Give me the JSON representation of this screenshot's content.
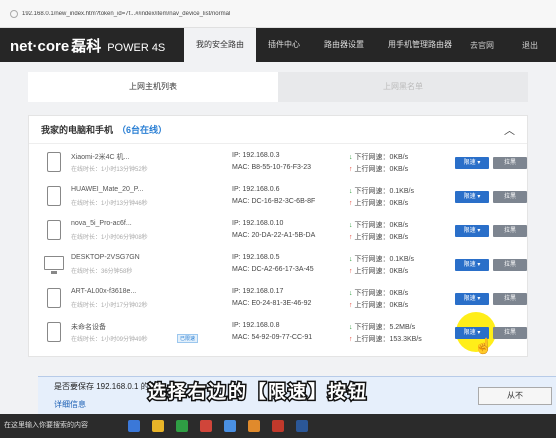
{
  "browser": {
    "url": "192.168.0.1/new_index.htm?token_id=7f...#/index/item/nav_device_list/normal"
  },
  "router": {
    "logo_brand": "net·core",
    "logo_cn": "磊科",
    "logo_model": "POWER 4S",
    "nav": [
      "我的安全路由",
      "插件中心",
      "路由器设置",
      "用手机管理路由器"
    ],
    "official_site": "去官网",
    "exit": "退出"
  },
  "subtabs": [
    "上网主机列表",
    "上网黑名单"
  ],
  "panel": {
    "title": "我家的电脑和手机",
    "online": "（6台在线）"
  },
  "devices": [
    {
      "name": "Xiaomi-2米4C 机...",
      "time": "在线时长：1小时13分钟52秒",
      "ip": "IP: 192.168.0.3",
      "mac": "MAC: B8-55-10-76-F3-23",
      "down": "下行网速：0KB/s",
      "up": "上行网速：0KB/s",
      "icon": "phone-icon"
    },
    {
      "name": "HUAWEI_Mate_20_P...",
      "time": "在线时长：1小时13分钟46秒",
      "ip": "IP: 192.168.0.6",
      "mac": "MAC: DC-16-B2-3C-6B-8F",
      "down": "下行网速：0.1KB/s",
      "up": "上行网速：0KB/s",
      "icon": "phone-icon"
    },
    {
      "name": "nova_5i_Pro-ac6f...",
      "time": "在线时长：1小时06分钟08秒",
      "ip": "IP: 192.168.0.10",
      "mac": "MAC: 20-DA-22-A1-5B-DA",
      "down": "下行网速：0KB/s",
      "up": "上行网速：0KB/s",
      "icon": "phone-icon"
    },
    {
      "name": "DESKTOP-2VSG7GN",
      "time": "在线时长：36分钟58秒",
      "ip": "IP: 192.168.0.5",
      "mac": "MAC: DC-A2-66-17-3A-45",
      "down": "下行网速：0.1KB/s",
      "up": "上行网速：0KB/s",
      "icon": "desktop-icon"
    },
    {
      "name": "ART-AL00x-f3618e...",
      "time": "在线时长：1小时17分钟02秒",
      "ip": "IP: 192.168.0.17",
      "mac": "MAC: E0-24-81-3E-46-92",
      "down": "下行网速：0KB/s",
      "up": "上行网速：0KB/s",
      "icon": "phone-icon"
    },
    {
      "name": "未命名设备",
      "time": "在线时长：1小时09分钟49秒",
      "badge": "已限速",
      "ip": "IP: 192.168.0.8",
      "mac": "MAC: 54-92-09-77-CC-91",
      "down": "下行网速：5.2MB/s",
      "up": "上行网速：153.3KB/s",
      "icon": "phone-icon"
    }
  ],
  "buttons": {
    "limit": "限速 ▾",
    "block": "拉黑"
  },
  "savebar": {
    "question": "是否要保存 192.168.0.1 的密",
    "details": "详细信息",
    "never": "从不"
  },
  "caption": "选择右边的【限速】按钮",
  "taskbar": {
    "search": "在这里输入你要搜索的内容"
  }
}
